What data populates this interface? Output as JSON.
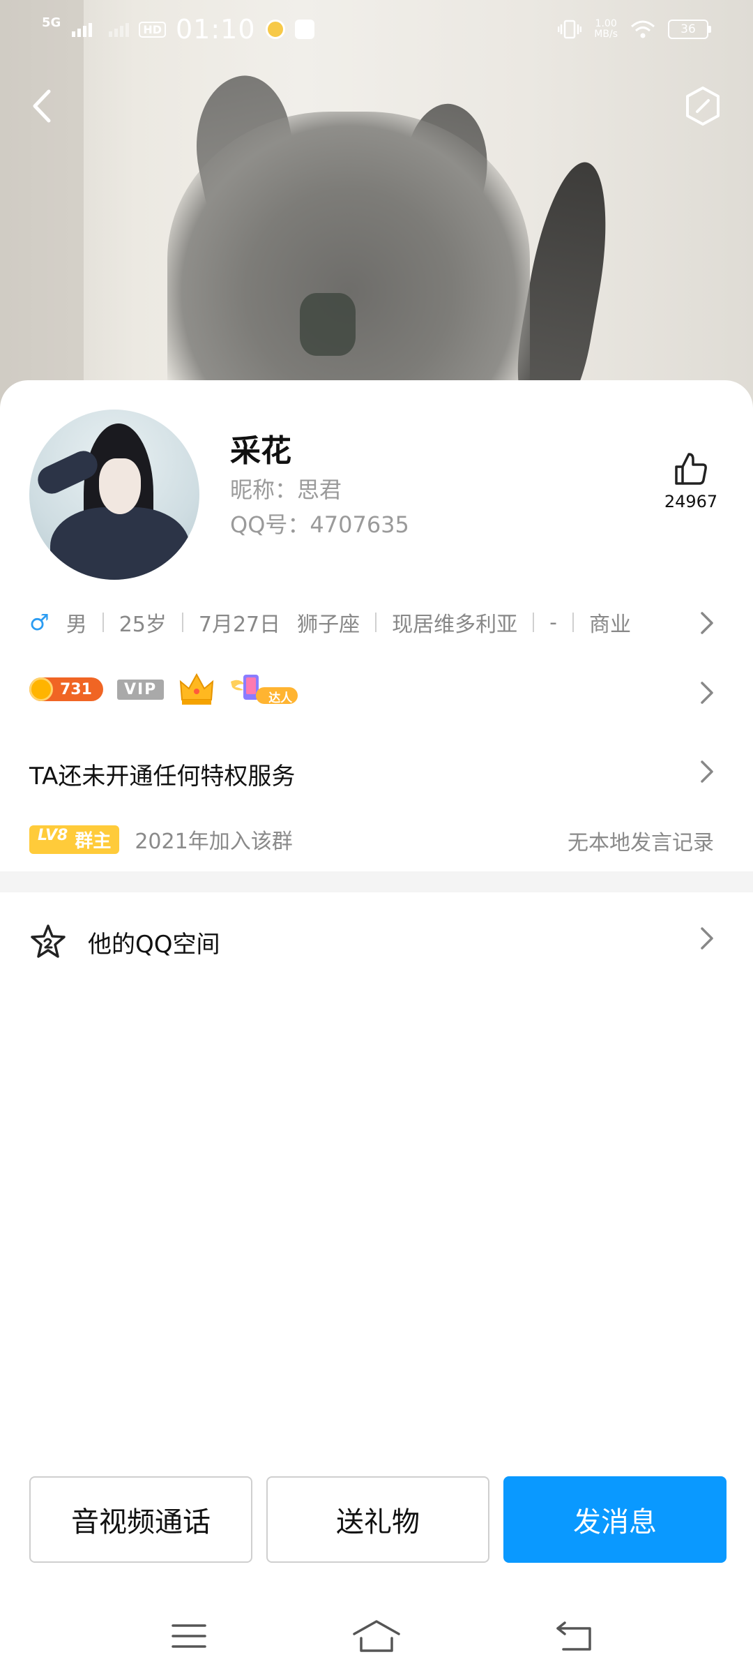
{
  "status_bar": {
    "network": "5G",
    "hd": "HD",
    "time": "01:10",
    "speed_value": "1.00",
    "speed_unit": "MB/s",
    "battery": "36"
  },
  "profile": {
    "name": "采花",
    "nickname": "昵称：思君",
    "qq_number": "QQ号：4707635",
    "likes": "24967"
  },
  "info": {
    "gender_symbol": "♂",
    "gender": "男",
    "age": "25岁",
    "birthday": "7月27日",
    "zodiac": "狮子座",
    "location": "现居维多利亚",
    "dash": "-",
    "industry": "商业"
  },
  "badges": {
    "coin_value": "731",
    "vip": "VIP",
    "talent": "达人"
  },
  "privilege_text": "TA还未开通任何特权服务",
  "group": {
    "level": "LV8",
    "role": "群主",
    "joined": "2021年加入该群",
    "no_local_records": "无本地发言记录"
  },
  "qzone_label": "他的QQ空间",
  "actions": {
    "call": "音视频通话",
    "gift": "送礼物",
    "message": "发消息"
  },
  "colors": {
    "primary": "#0a99ff",
    "gender_blue": "#2b9cf2",
    "level_badge": "#ffcb3a",
    "coin_badge": "#f06524"
  }
}
